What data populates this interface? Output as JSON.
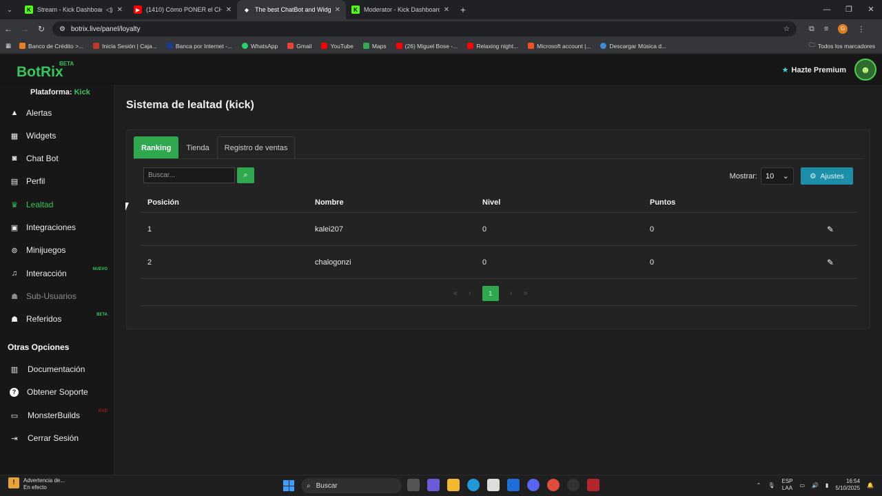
{
  "browser": {
    "tabs": [
      {
        "title": "Stream - Kick Dashboard",
        "color": "#53fc18",
        "glyph": "K",
        "active": false
      },
      {
        "title": "(1410) Cómo PONER el CHAT d",
        "color": "#ff0000",
        "glyph": "▶",
        "active": false
      },
      {
        "title": "The best ChatBot and Widgets",
        "color": "#ffffff",
        "glyph": "◆",
        "active": true
      },
      {
        "title": "Moderator - Kick Dashboard",
        "color": "#53fc18",
        "glyph": "K",
        "active": false
      }
    ],
    "url": "botrix.live/panel/loyalty",
    "bookmarks": [
      {
        "label": "Banco de Crédito >...",
        "color": "#e67e22"
      },
      {
        "label": "Inicia Sesión | Caja...",
        "color": "#c0392b"
      },
      {
        "label": "Banca por Internet -...",
        "color": "#1a3a8f"
      },
      {
        "label": "WhatsApp",
        "color": "#25d366"
      },
      {
        "label": "Gmail",
        "color": "#ea4335"
      },
      {
        "label": "YouTube",
        "color": "#ff0000"
      },
      {
        "label": "Maps",
        "color": "#34a853"
      },
      {
        "label": "(26) Miguel Bose -...",
        "color": "#ff0000"
      },
      {
        "label": "Relaxing night...",
        "color": "#ff0000"
      },
      {
        "label": "Microsoft account |...",
        "color": "#f25022"
      },
      {
        "label": "Descargar Música d...",
        "color": "#3c8dd9"
      }
    ],
    "bookmarks_folder": "Todos los marcadores",
    "profile_initial": "G"
  },
  "header": {
    "logo": "BotRix",
    "logo_badge": "BETA",
    "premium_label": "Hazte Premium"
  },
  "sidebar": {
    "platform_label": "Plataforma:",
    "platform_value": "Kick",
    "items": [
      {
        "label": "Alertas",
        "icon": "warning-icon",
        "glyph": "⚠"
      },
      {
        "label": "Widgets",
        "icon": "grid-icon",
        "glyph": "▦"
      },
      {
        "label": "Chat Bot",
        "icon": "robot-icon",
        "glyph": "🤖"
      },
      {
        "label": "Perfil",
        "icon": "id-card-icon",
        "glyph": "▤"
      },
      {
        "label": "Lealtad",
        "icon": "trophy-icon",
        "glyph": "🏆",
        "active": true
      },
      {
        "label": "Integraciones",
        "icon": "integrations-icon",
        "glyph": "▣"
      },
      {
        "label": "Minijuegos",
        "icon": "gamepad-icon",
        "glyph": "🎮"
      },
      {
        "label": "Interacción",
        "icon": "music-icon",
        "glyph": "♫",
        "badge": "NUEVO"
      },
      {
        "label": "Sub-Usuarios",
        "icon": "users-icon",
        "glyph": "👥",
        "muted": true
      },
      {
        "label": "Referidos",
        "icon": "referrals-icon",
        "glyph": "👥",
        "badge": "BETA"
      }
    ],
    "other_title": "Otras Opciones",
    "other_items": [
      {
        "label": "Documentación",
        "icon": "book-icon",
        "glyph": "📘"
      },
      {
        "label": "Obtener Soporte",
        "icon": "help-icon",
        "glyph": "?"
      },
      {
        "label": "MonsterBuilds",
        "icon": "laptop-icon",
        "glyph": "💻",
        "badge": "RAD"
      },
      {
        "label": "Cerrar Sesión",
        "icon": "logout-icon",
        "glyph": "⇥"
      }
    ]
  },
  "main": {
    "title": "Sistema de lealtad (kick)",
    "tabs": [
      "Ranking",
      "Tienda",
      "Registro de ventas"
    ],
    "search_placeholder": "Buscar...",
    "show_label": "Mostrar:",
    "show_value": "10",
    "settings_label": "Ajustes",
    "columns": [
      "Posición",
      "Nombre",
      "Nivel",
      "Puntos"
    ],
    "rows": [
      {
        "position": "1",
        "name": "kalei207",
        "level": "0",
        "points": "0"
      },
      {
        "position": "2",
        "name": "chalogonzi",
        "level": "0",
        "points": "0"
      }
    ],
    "current_page": "1"
  },
  "taskbar": {
    "warning_title": "Advertencia de...",
    "warning_sub": "En efecto",
    "search_label": "Buscar",
    "lang_top": "ESP",
    "lang_bottom": "LAA",
    "time": "16:54",
    "date": "5/10/2025"
  },
  "colors": {
    "accent": "#2fa84f",
    "brand": "#35c759",
    "info": "#1d8fa8"
  }
}
